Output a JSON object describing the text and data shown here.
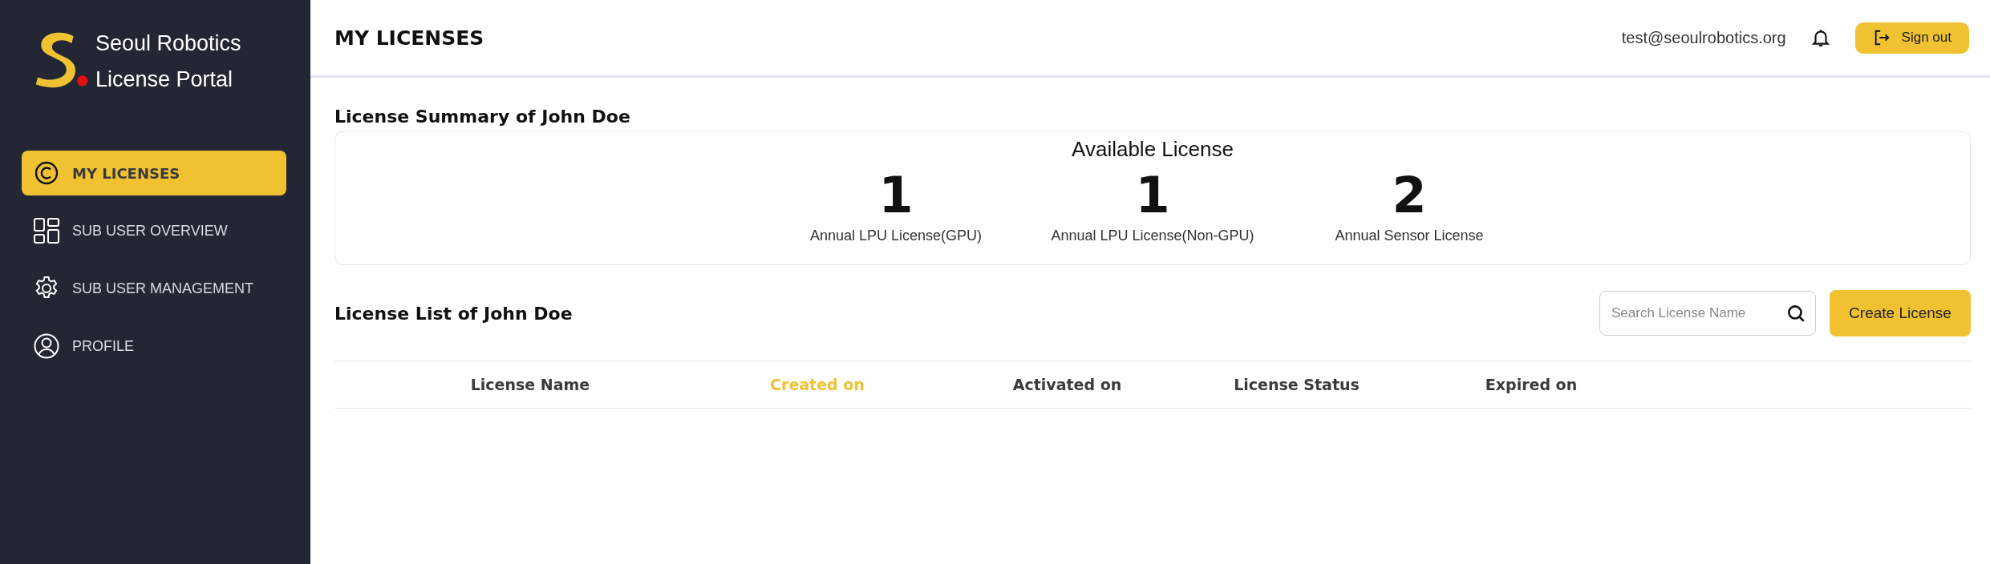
{
  "brand": {
    "lines": [
      "Seoul Robotics",
      "License Portal"
    ]
  },
  "sidebar": {
    "items": [
      {
        "label": "MY LICENSES",
        "selected": true
      },
      {
        "label": "SUB USER OVERVIEW",
        "selected": false
      },
      {
        "label": "SUB USER MANAGEMENT",
        "selected": false
      },
      {
        "label": "PROFILE",
        "selected": false
      }
    ]
  },
  "header": {
    "title": "MY LICENSES",
    "email": "test@seoulrobotics.org",
    "sign_out": "Sign out"
  },
  "summary": {
    "title": "License Summary of John Doe",
    "heading": "Available License",
    "stats": [
      {
        "value": "1",
        "label": "Annual LPU License(GPU)"
      },
      {
        "value": "1",
        "label": "Annual LPU License(Non-GPU)"
      },
      {
        "value": "2",
        "label": "Annual Sensor License"
      }
    ]
  },
  "list": {
    "title": "License List of John Doe",
    "search": {
      "placeholder": "Search License Name"
    },
    "create_button": "Create License",
    "columns": [
      {
        "label": "License Name",
        "selected": false
      },
      {
        "label": "Created on",
        "selected": true
      },
      {
        "label": "Activated on",
        "selected": false
      },
      {
        "label": "License Status",
        "selected": false
      },
      {
        "label": "Expired on",
        "selected": false
      }
    ]
  }
}
